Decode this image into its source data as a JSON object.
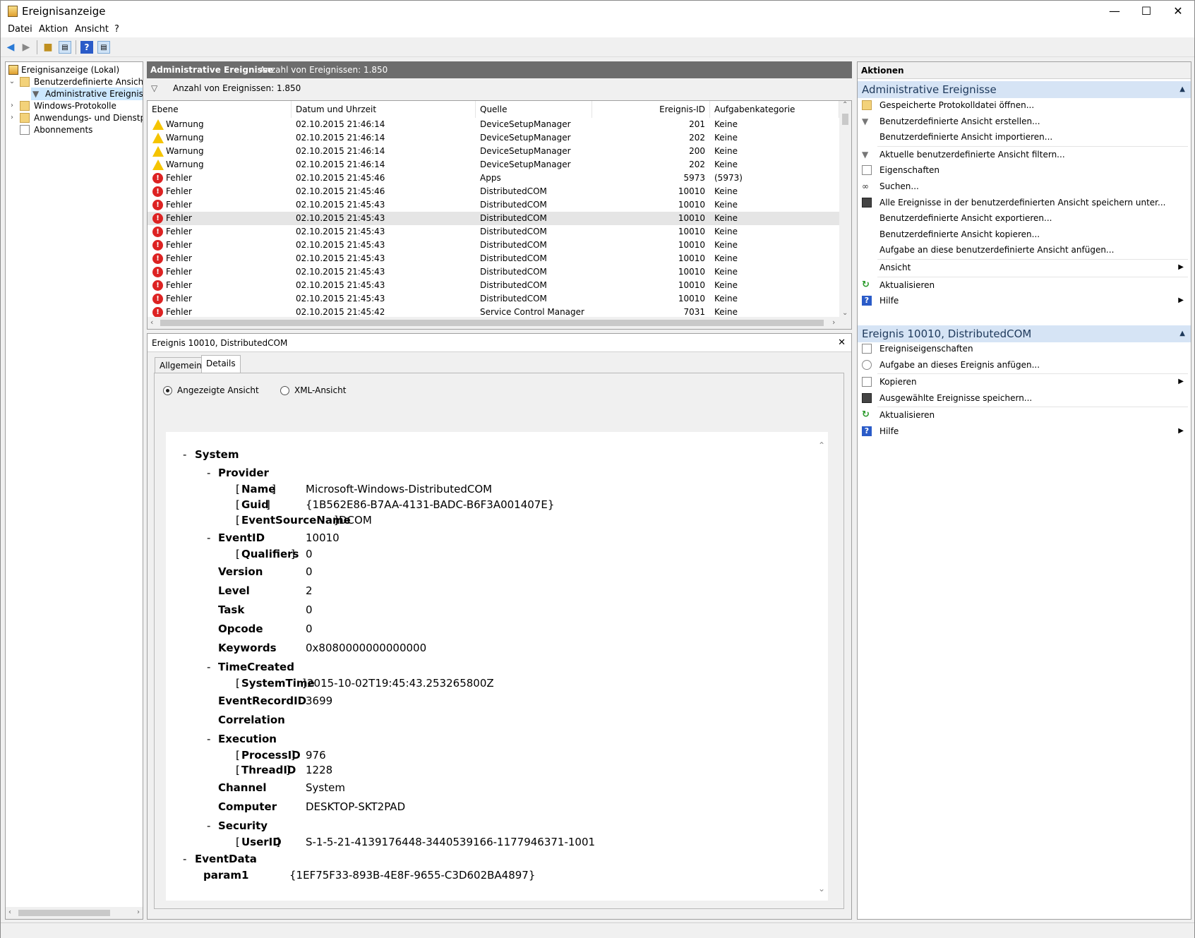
{
  "window": {
    "title": "Ereignisanzeige",
    "minimize": "—",
    "maximize": "☐",
    "close": "✕"
  },
  "menu": [
    "Datei",
    "Aktion",
    "Ansicht",
    "?"
  ],
  "tree": {
    "root": "Ereignisanzeige (Lokal)",
    "items": [
      {
        "label": "Benutzerdefinierte Ansichten",
        "expanded": true
      },
      {
        "label": "Administrative Ereignisse",
        "selected": true
      },
      {
        "label": "Windows-Protokolle",
        "expanded": false
      },
      {
        "label": "Anwendungs- und Dienstprotokolle",
        "expanded": false
      },
      {
        "label": "Abonnements"
      }
    ]
  },
  "view_header": {
    "title": "Administrative Ereignisse",
    "count": "Anzahl von Ereignissen: 1.850"
  },
  "filter_bar": {
    "text": "Anzahl von Ereignissen: 1.850"
  },
  "columns": [
    "Ebene",
    "Datum und Uhrzeit",
    "Quelle",
    "Ereignis-ID",
    "Aufgabenkategorie"
  ],
  "events": [
    {
      "level": "Warnung",
      "type": "warning",
      "datetime": "02.10.2015 21:46:14",
      "source": "DeviceSetupManager",
      "id": "201",
      "category": "Keine"
    },
    {
      "level": "Warnung",
      "type": "warning",
      "datetime": "02.10.2015 21:46:14",
      "source": "DeviceSetupManager",
      "id": "202",
      "category": "Keine"
    },
    {
      "level": "Warnung",
      "type": "warning",
      "datetime": "02.10.2015 21:46:14",
      "source": "DeviceSetupManager",
      "id": "200",
      "category": "Keine"
    },
    {
      "level": "Warnung",
      "type": "warning",
      "datetime": "02.10.2015 21:46:14",
      "source": "DeviceSetupManager",
      "id": "202",
      "category": "Keine"
    },
    {
      "level": "Fehler",
      "type": "error",
      "datetime": "02.10.2015 21:45:46",
      "source": "Apps",
      "id": "5973",
      "category": "(5973)"
    },
    {
      "level": "Fehler",
      "type": "error",
      "datetime": "02.10.2015 21:45:46",
      "source": "DistributedCOM",
      "id": "10010",
      "category": "Keine"
    },
    {
      "level": "Fehler",
      "type": "error",
      "datetime": "02.10.2015 21:45:43",
      "source": "DistributedCOM",
      "id": "10010",
      "category": "Keine"
    },
    {
      "level": "Fehler",
      "type": "error",
      "datetime": "02.10.2015 21:45:43",
      "source": "DistributedCOM",
      "id": "10010",
      "category": "Keine",
      "selected": true
    },
    {
      "level": "Fehler",
      "type": "error",
      "datetime": "02.10.2015 21:45:43",
      "source": "DistributedCOM",
      "id": "10010",
      "category": "Keine"
    },
    {
      "level": "Fehler",
      "type": "error",
      "datetime": "02.10.2015 21:45:43",
      "source": "DistributedCOM",
      "id": "10010",
      "category": "Keine"
    },
    {
      "level": "Fehler",
      "type": "error",
      "datetime": "02.10.2015 21:45:43",
      "source": "DistributedCOM",
      "id": "10010",
      "category": "Keine"
    },
    {
      "level": "Fehler",
      "type": "error",
      "datetime": "02.10.2015 21:45:43",
      "source": "DistributedCOM",
      "id": "10010",
      "category": "Keine"
    },
    {
      "level": "Fehler",
      "type": "error",
      "datetime": "02.10.2015 21:45:43",
      "source": "DistributedCOM",
      "id": "10010",
      "category": "Keine"
    },
    {
      "level": "Fehler",
      "type": "error",
      "datetime": "02.10.2015 21:45:43",
      "source": "DistributedCOM",
      "id": "10010",
      "category": "Keine"
    },
    {
      "level": "Fehler",
      "type": "error",
      "datetime": "02.10.2015 21:45:42",
      "source": "Service Control Manager",
      "id": "7031",
      "category": "Keine"
    }
  ],
  "detail": {
    "title": "Ereignis 10010, DistributedCOM",
    "close": "✕",
    "tabs": [
      "Allgemein",
      "Details"
    ],
    "active_tab": "Details",
    "radio_friendly": "Angezeigte Ansicht",
    "radio_xml": "XML-Ansicht",
    "selected_view": "Angezeigte Ansicht",
    "xml": {
      "system": "System",
      "provider": "Provider",
      "name_key": "Name",
      "name_val": "Microsoft-Windows-DistributedCOM",
      "guid_key": "Guid",
      "guid_val": "{1B562E86-B7AA-4131-BADC-B6F3A001407E}",
      "esn_key": "EventSourceName",
      "esn_val": "DCOM",
      "eventid_key": "EventID",
      "eventid_val": "10010",
      "qualifiers_key": "Qualifiers",
      "qualifiers_val": "0",
      "version_key": "Version",
      "version_val": "0",
      "level_key": "Level",
      "level_val": "2",
      "task_key": "Task",
      "task_val": "0",
      "opcode_key": "Opcode",
      "opcode_val": "0",
      "keywords_key": "Keywords",
      "keywords_val": "0x8080000000000000",
      "timecreated": "TimeCreated",
      "systemtime_key": "SystemTime",
      "systemtime_val": "2015-10-02T19:45:43.253265800Z",
      "recordid_key": "EventRecordID",
      "recordid_val": "3699",
      "correlation": "Correlation",
      "execution": "Execution",
      "processid_key": "ProcessID",
      "processid_val": "976",
      "threadid_key": "ThreadID",
      "threadid_val": "1228",
      "channel_key": "Channel",
      "channel_val": "System",
      "computer_key": "Computer",
      "computer_val": "DESKTOP-SKT2PAD",
      "security": "Security",
      "userid_key": "UserID",
      "userid_val": "S-1-5-21-4139176448-3440539166-1177946371-1001",
      "eventdata": "EventData",
      "param1_key": "param1",
      "param1_val": "{1EF75F33-893B-4E8F-9655-C3D602BA4897}",
      "dash": "-",
      "lbr": "[",
      "rbr": "]"
    }
  },
  "actions": {
    "header": "Aktionen",
    "section1": {
      "title": "Administrative Ereignisse",
      "items": [
        {
          "label": "Gespeicherte Protokolldatei öffnen...",
          "icon": "folder-open-icon"
        },
        {
          "label": "Benutzerdefinierte Ansicht erstellen...",
          "icon": "filter-icon"
        },
        {
          "label": "Benutzerdefinierte Ansicht importieren...",
          "icon": ""
        },
        {
          "label": "Aktuelle benutzerdefinierte Ansicht filtern...",
          "icon": "filter-icon"
        },
        {
          "label": "Eigenschaften",
          "icon": "properties-icon"
        },
        {
          "label": "Suchen...",
          "icon": "binoculars-icon"
        },
        {
          "label": "Alle Ereignisse in der benutzerdefinierten Ansicht speichern unter...",
          "icon": "save-icon"
        },
        {
          "label": "Benutzerdefinierte Ansicht exportieren...",
          "icon": ""
        },
        {
          "label": "Benutzerdefinierte Ansicht kopieren...",
          "icon": ""
        },
        {
          "label": "Aufgabe an diese benutzerdefinierte Ansicht anfügen...",
          "icon": ""
        },
        {
          "label": "Ansicht",
          "icon": "",
          "submenu": true
        },
        {
          "label": "Aktualisieren",
          "icon": "refresh-icon"
        },
        {
          "label": "Hilfe",
          "icon": "help-icon",
          "submenu": true
        }
      ]
    },
    "section2": {
      "title": "Ereignis 10010, DistributedCOM",
      "items": [
        {
          "label": "Ereigniseigenschaften",
          "icon": "properties-icon"
        },
        {
          "label": "Aufgabe an dieses Ereignis anfügen...",
          "icon": "task-icon"
        },
        {
          "label": "Kopieren",
          "icon": "copy-icon",
          "submenu": true
        },
        {
          "label": "Ausgewählte Ereignisse speichern...",
          "icon": "save-icon"
        },
        {
          "label": "Aktualisieren",
          "icon": "refresh-icon"
        },
        {
          "label": "Hilfe",
          "icon": "help-icon",
          "submenu": true
        }
      ]
    }
  },
  "colors": {
    "accent_header": "#6d6d6d",
    "section_bg": "#d6e4f5",
    "section_text": "#1e395b",
    "error": "#dd2222",
    "warning": "#f5c400",
    "selected_row": "#e5e5e5"
  }
}
